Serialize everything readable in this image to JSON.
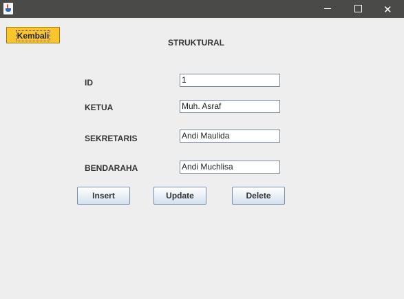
{
  "window": {
    "title": "",
    "close_glyph": "✕"
  },
  "nav": {
    "back_label": "Kembali"
  },
  "form": {
    "title": "STRUKTURAL",
    "fields": [
      {
        "label": "ID",
        "value": "1"
      },
      {
        "label": "KETUA",
        "value": "Muh. Asraf"
      },
      {
        "label": "SEKRETARIS",
        "value": "Andi Maulida"
      },
      {
        "label": "BENDARAHA",
        "value": "Andi Muchlisa"
      }
    ]
  },
  "actions": {
    "insert_label": "Insert",
    "update_label": "Update",
    "delete_label": "Delete"
  },
  "colors": {
    "titlebar": "#4a4a48",
    "back_button": "#fcc52c",
    "background": "#eeeeee"
  },
  "icons": [
    "java-app-icon",
    "minimize-icon",
    "maximize-icon",
    "close-icon"
  ]
}
